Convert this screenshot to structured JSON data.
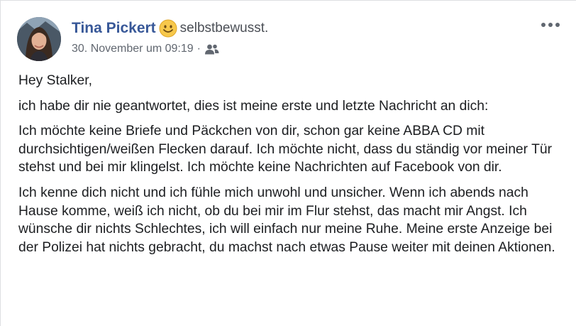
{
  "post": {
    "author": {
      "name": "Tina Pickert",
      "avatar_icon": "profile-photo"
    },
    "feeling": {
      "emoji_icon": "smiling-face-icon",
      "text": "selbstbewusst."
    },
    "meta": {
      "timestamp": "30. November um 09:19",
      "separator": "·",
      "audience_icon": "friends-icon"
    },
    "menu_icon": "more-options-icon",
    "paragraphs": [
      "Hey Stalker,",
      "ich habe dir nie geantwortet, dies ist meine erste und letzte Nachricht an dich:",
      "Ich möchte keine Briefe und Päckchen von dir, schon gar keine ABBA CD mit durchsichtigen/weißen Flecken darauf. Ich möchte nicht, dass du ständig vor meiner Tür stehst und bei mir klingelst. Ich möchte keine Nachrichten auf Facebook von dir.",
      "Ich kenne dich nicht und ich fühle mich unwohl und unsicher. Wenn ich abends nach Hause komme, weiß ich nicht, ob du bei mir im Flur stehst, das macht mir Angst. Ich wünsche dir nichts Schlechtes, ich will einfach nur meine Ruhe. Meine erste Anzeige bei der Polizei hat nichts gebracht, du machst nach etwas Pause weiter mit deinen Aktionen."
    ]
  },
  "colors": {
    "author_link": "#385898",
    "body_text": "#1c1e21",
    "meta_text": "#616770",
    "border": "#dddfe2"
  }
}
